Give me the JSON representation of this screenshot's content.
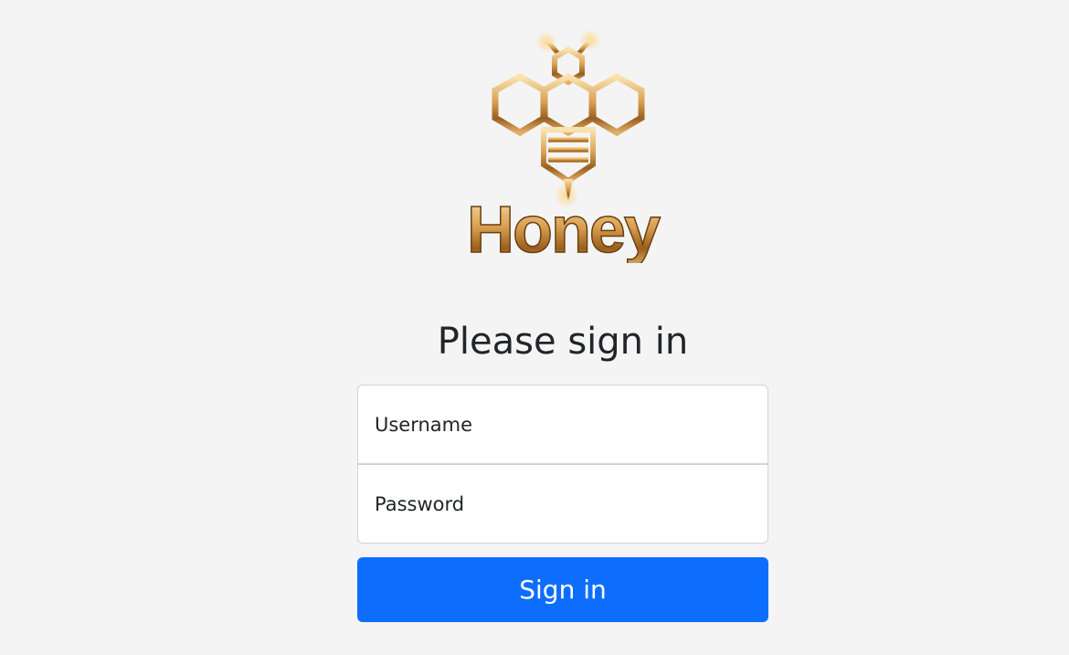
{
  "logo": {
    "text": "Honey",
    "gold_light": "#f6d79a",
    "gold_mid": "#d79a48",
    "gold_dark": "#7a4a14"
  },
  "heading": "Please sign in",
  "form": {
    "username_placeholder": "Username",
    "password_placeholder": "Password",
    "submit_label": "Sign in"
  },
  "colors": {
    "background": "#f4f4f4",
    "primary": "#0d6efd"
  }
}
